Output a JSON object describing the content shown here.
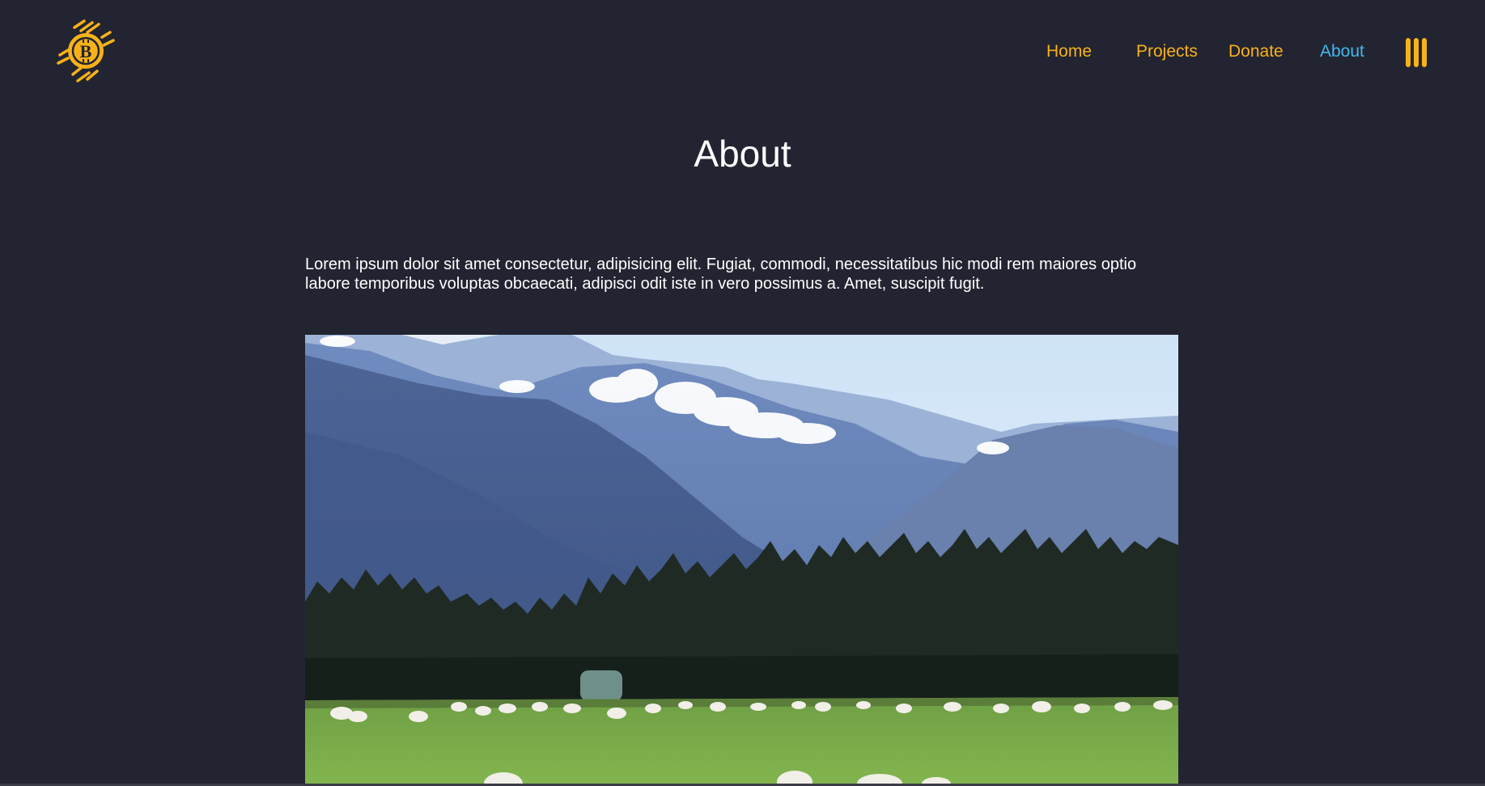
{
  "header": {
    "logo_icon": "bitcoin-icon",
    "brand_color": "#f7b219",
    "active_color": "#42b7ee",
    "nav": [
      {
        "label": "Home",
        "active": false
      },
      {
        "label": "Projects",
        "active": false
      },
      {
        "label": "Donate",
        "active": false
      },
      {
        "label": "About",
        "active": true
      }
    ],
    "menu_icon": "menu-bars-icon"
  },
  "main": {
    "title": "About",
    "intro": "Lorem ipsum dolor sit amet consectetur, adipisicing elit. Fugiat, commodi, necessitatibus hic modi rem maiores optio labore temporibus voluptas obcaecati, adipisci odit iste in vero possimus a. Amet, suscipit fugit.",
    "photo_subject": "landscape-photo"
  },
  "colors": {
    "background": "#232431",
    "text": "#ffffff"
  }
}
